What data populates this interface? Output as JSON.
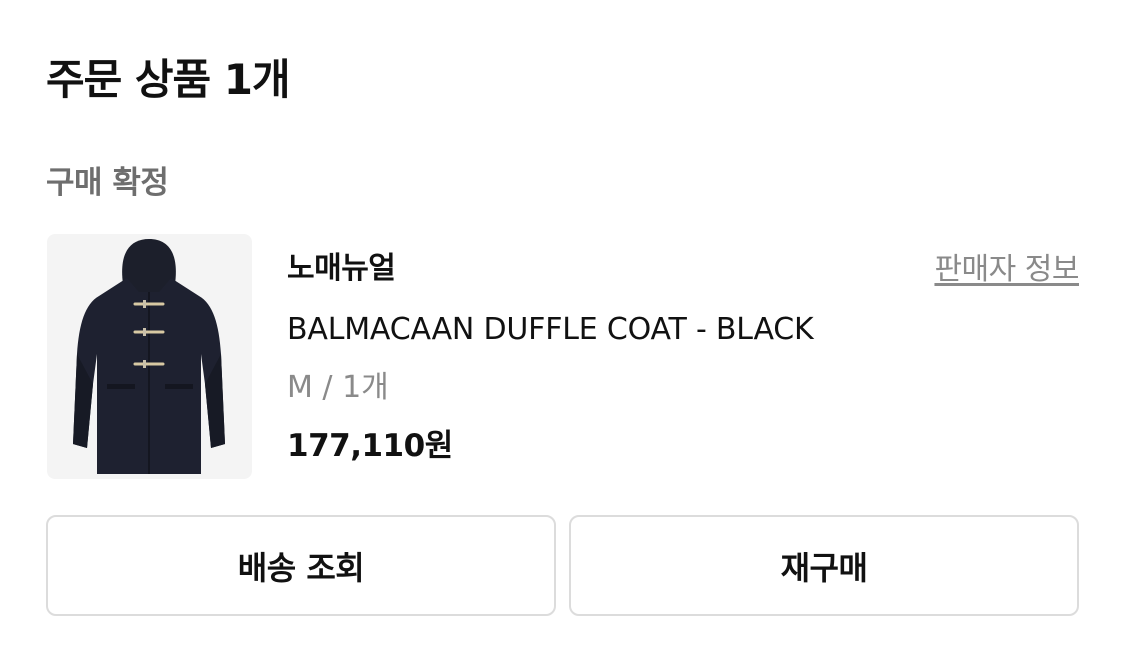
{
  "header": {
    "title": "주문 상품 1개"
  },
  "order": {
    "status": "구매 확정",
    "item": {
      "brand": "노매뉴얼",
      "seller_info_label": "판매자 정보",
      "product_name": "BALMACAAN DUFFLE COAT - BLACK",
      "option": "M / 1개",
      "price": "177,110원",
      "image_icon": "duffle-coat-image"
    }
  },
  "actions": {
    "track_shipping_label": "배송 조회",
    "reorder_label": "재구매"
  },
  "colors": {
    "muted_text": "#8a8a8a",
    "status_text": "#6e6e6e",
    "button_border": "#dcdcdc",
    "thumb_bg": "#f4f4f4"
  }
}
